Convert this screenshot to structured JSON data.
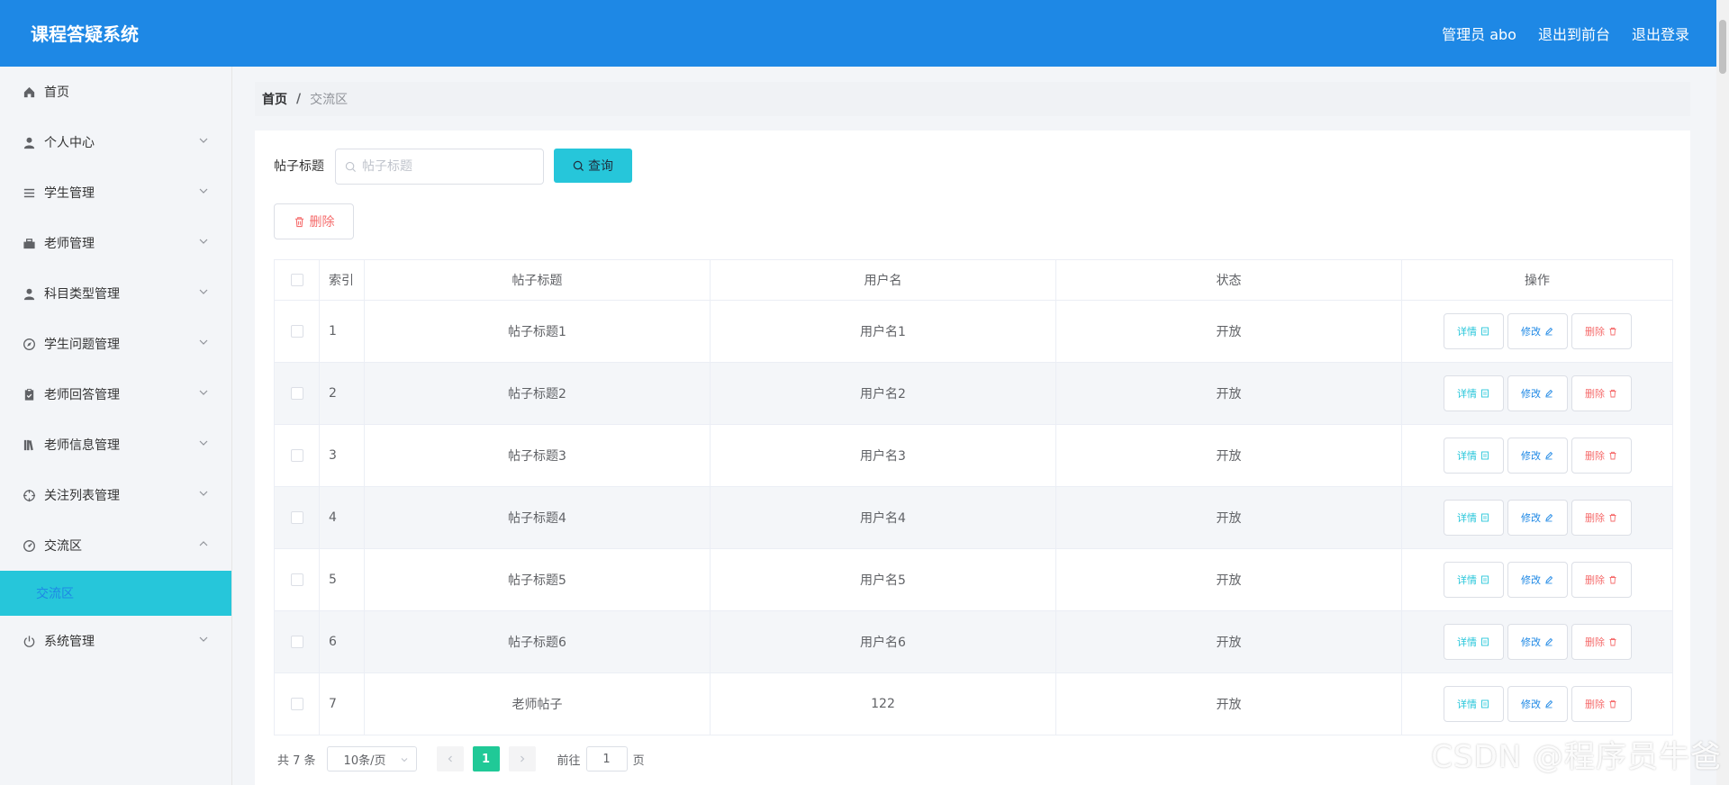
{
  "header": {
    "title": "课程答疑系统",
    "user_label": "管理员 abo",
    "front_link": "退出到前台",
    "logout_link": "退出登录"
  },
  "sidebar": {
    "items": [
      {
        "label": "首页",
        "icon": "home-icon"
      },
      {
        "label": "个人中心",
        "icon": "user-icon"
      },
      {
        "label": "学生管理",
        "icon": "list-icon"
      },
      {
        "label": "老师管理",
        "icon": "briefcase-icon"
      },
      {
        "label": "科目类型管理",
        "icon": "user-icon"
      },
      {
        "label": "学生问题管理",
        "icon": "compass-icon"
      },
      {
        "label": "老师回答管理",
        "icon": "clipboard-icon"
      },
      {
        "label": "老师信息管理",
        "icon": "books-icon"
      },
      {
        "label": "关注列表管理",
        "icon": "crosshair-icon"
      },
      {
        "label": "交流区",
        "icon": "gauge-icon"
      },
      {
        "label": "系统管理",
        "icon": "power-icon"
      }
    ],
    "submenu_active": "交流区"
  },
  "breadcrumb": {
    "home": "首页",
    "separator": "/",
    "current": "交流区"
  },
  "search": {
    "label": "帖子标题",
    "placeholder": "帖子标题",
    "query_button": "查询"
  },
  "toolbar": {
    "delete_button": "删除"
  },
  "table": {
    "headers": [
      "索引",
      "帖子标题",
      "用户名",
      "状态",
      "操作"
    ],
    "rows": [
      {
        "index": "1",
        "title": "帖子标题1",
        "username": "用户名1",
        "status": "开放"
      },
      {
        "index": "2",
        "title": "帖子标题2",
        "username": "用户名2",
        "status": "开放"
      },
      {
        "index": "3",
        "title": "帖子标题3",
        "username": "用户名3",
        "status": "开放"
      },
      {
        "index": "4",
        "title": "帖子标题4",
        "username": "用户名4",
        "status": "开放"
      },
      {
        "index": "5",
        "title": "帖子标题5",
        "username": "用户名5",
        "status": "开放"
      },
      {
        "index": "6",
        "title": "帖子标题6",
        "username": "用户名6",
        "status": "开放"
      },
      {
        "index": "7",
        "title": "老师帖子",
        "username": "122",
        "status": "开放"
      }
    ],
    "ops": {
      "detail": "详情",
      "edit": "修改",
      "delete": "删除"
    }
  },
  "pagination": {
    "total": "共 7 条",
    "page_size": "10条/页",
    "current_page": "1",
    "goto_label": "前往",
    "goto_value": "1",
    "goto_suffix": "页"
  },
  "watermark": "CSDN @程序员牛爸",
  "colors": {
    "header_bg": "#1e88e5",
    "accent_cyan": "#26c6da",
    "pager_active": "#20c997",
    "danger": "#f56c6c"
  }
}
